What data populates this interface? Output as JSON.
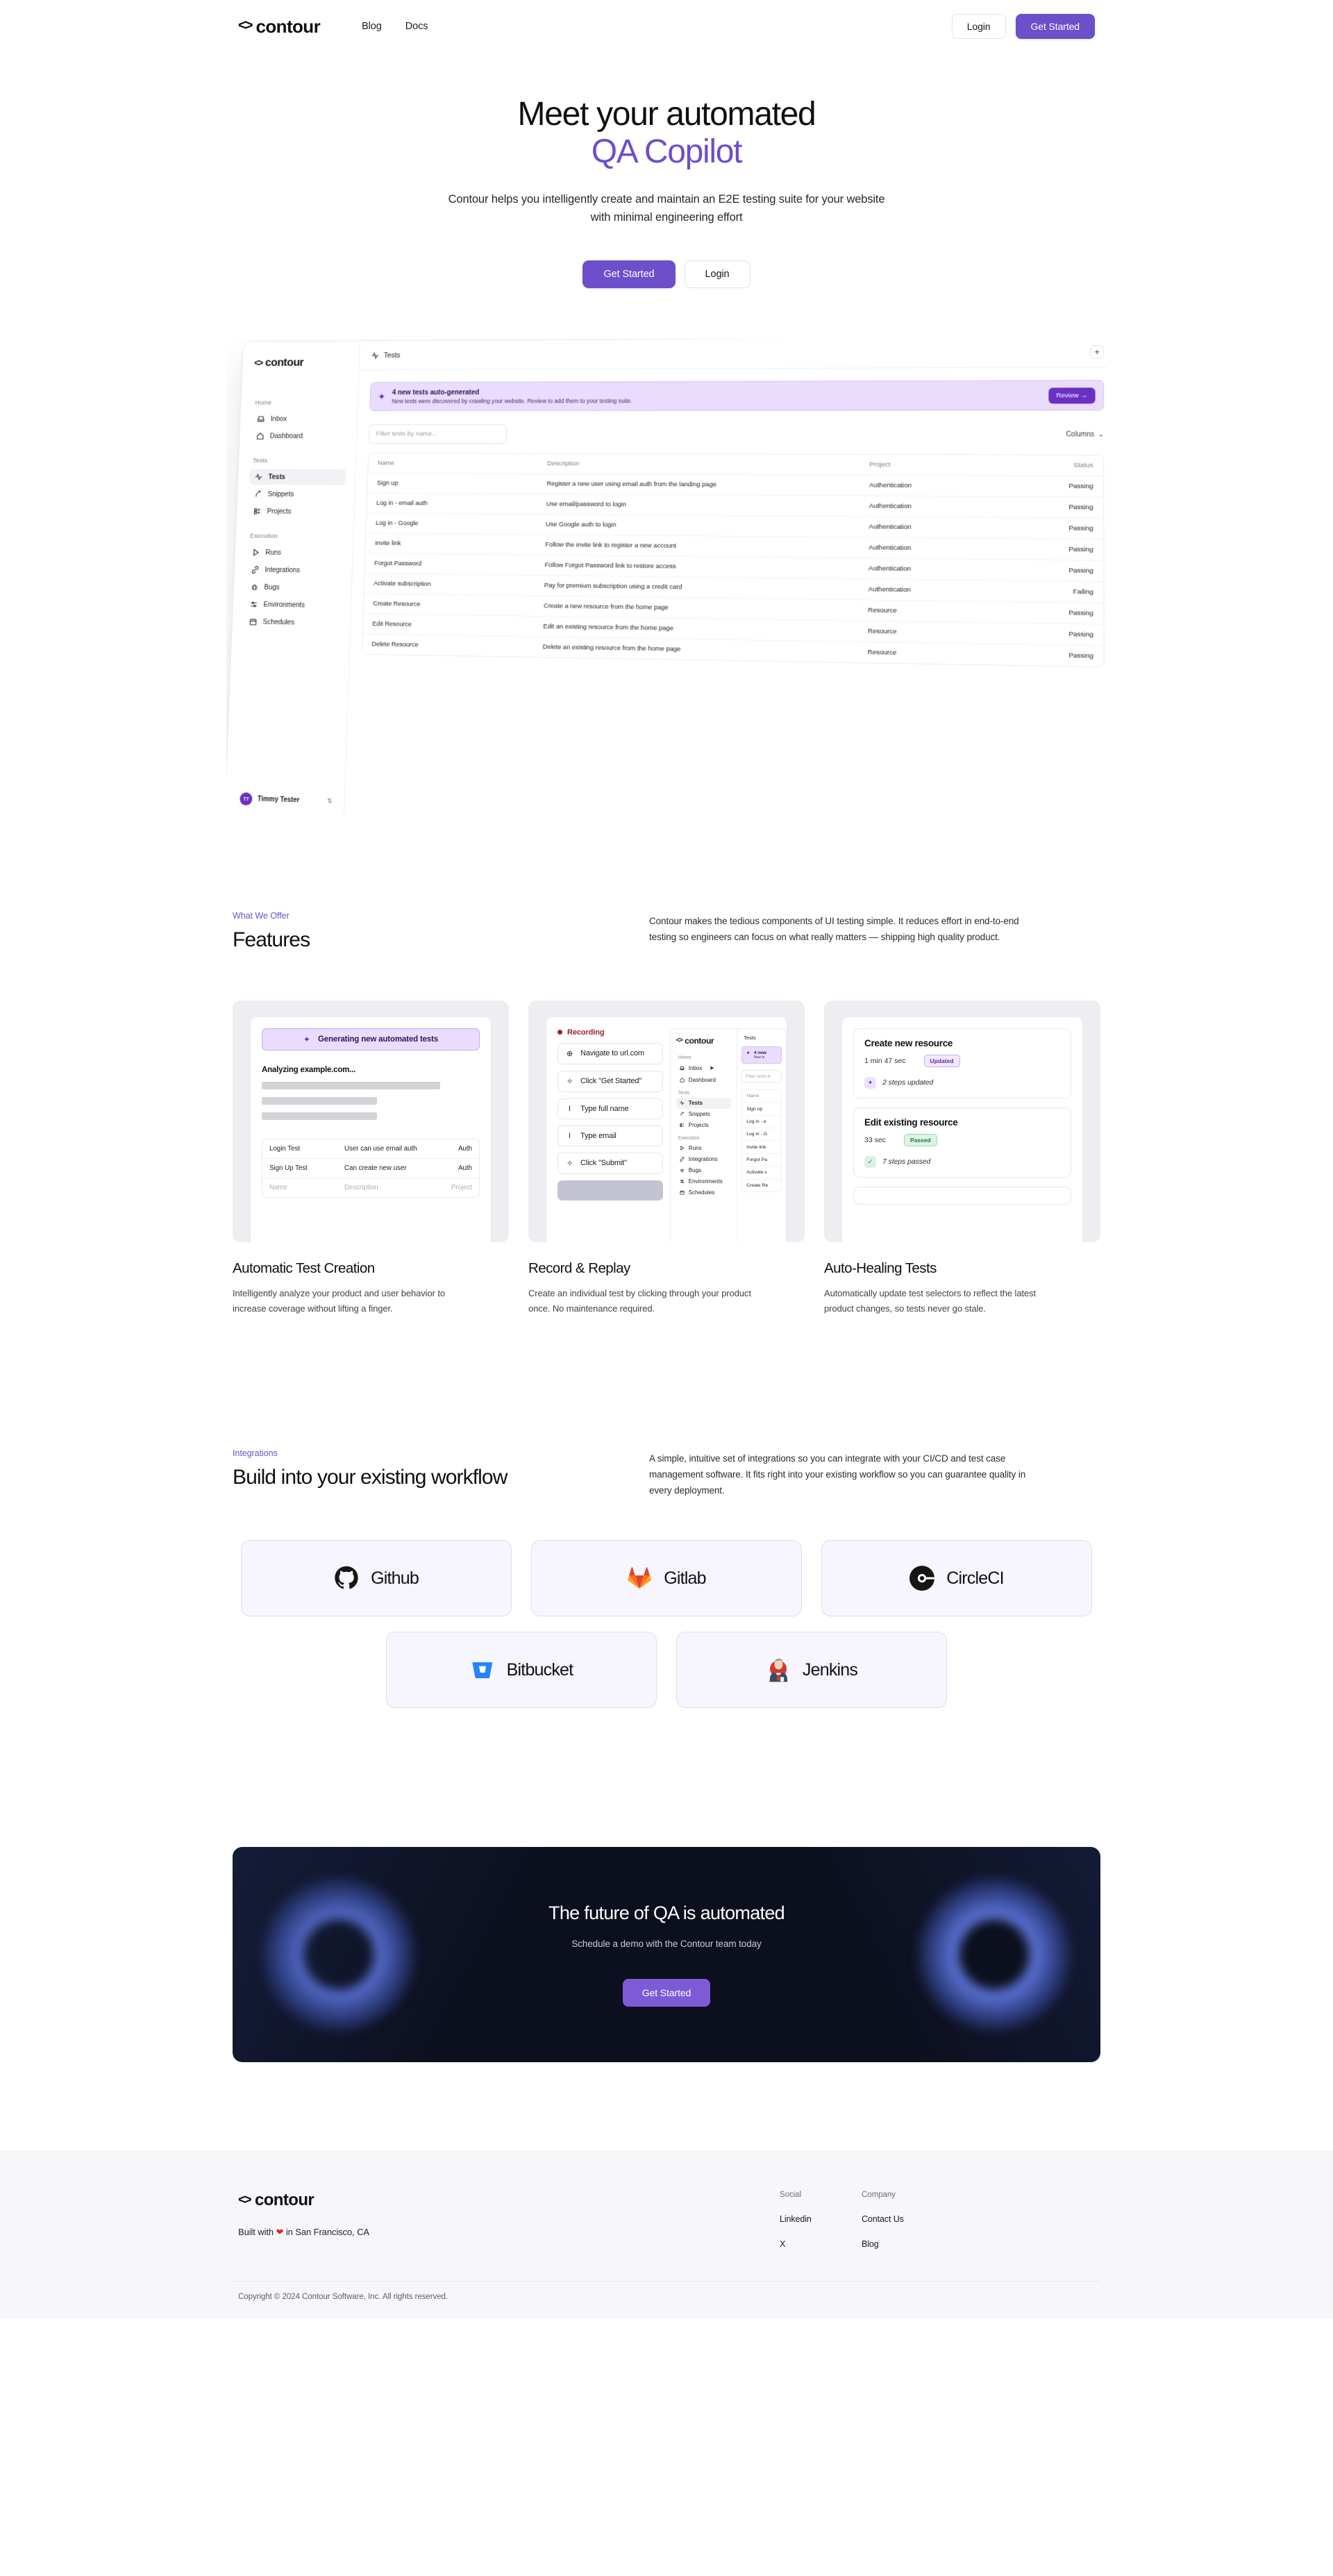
{
  "brand": {
    "name": "contour",
    "mark": "<>"
  },
  "nav": {
    "links": [
      {
        "label": "Blog"
      },
      {
        "label": "Docs"
      }
    ],
    "login_label": "Login",
    "get_started_label": "Get Started"
  },
  "hero": {
    "title_line1": "Meet your automated",
    "title_line2": "QA Copilot",
    "subtitle": "Contour helps you intelligently create and maintain an E2E testing suite for your website with minimal engineering effort",
    "primary_cta": "Get Started",
    "secondary_cta": "Login"
  },
  "app_mockup": {
    "logo": "contour",
    "sidebar": {
      "groups": [
        {
          "label": "Home",
          "items": [
            {
              "label": "Inbox",
              "icon": "inbox-icon",
              "active": false
            },
            {
              "label": "Dashboard",
              "icon": "home-icon",
              "active": false
            }
          ]
        },
        {
          "label": "Tests",
          "items": [
            {
              "label": "Tests",
              "icon": "pulse-icon",
              "active": true
            },
            {
              "label": "Snippets",
              "icon": "snippet-icon",
              "active": false
            },
            {
              "label": "Projects",
              "icon": "projects-icon",
              "active": false
            }
          ]
        },
        {
          "label": "Execution",
          "items": [
            {
              "label": "Runs",
              "icon": "play-icon",
              "active": false
            },
            {
              "label": "Integrations",
              "icon": "link-icon",
              "active": false
            },
            {
              "label": "Bugs",
              "icon": "bug-icon",
              "active": false
            },
            {
              "label": "Environments",
              "icon": "sliders-icon",
              "active": false
            },
            {
              "label": "Schedules",
              "icon": "calendar-icon",
              "active": false
            }
          ]
        }
      ],
      "user": {
        "initials": "TT",
        "name": "Timmy Tester"
      }
    },
    "topbar": {
      "title": "Tests",
      "add_label": "+"
    },
    "banner": {
      "title": "4 new tests auto-generated",
      "subtitle": "New tests were discovered by crawling your website. Review to add them to your testing suite.",
      "cta": "Review →"
    },
    "filter_placeholder": "Filter tests by name...",
    "columns_label": "Columns",
    "table": {
      "headers": [
        "Name",
        "Description",
        "Project",
        "Status"
      ],
      "rows": [
        {
          "name": "Sign up",
          "description": "Register a new user using email auth from the landing page",
          "project": "Authentication",
          "status": "Passing"
        },
        {
          "name": "Log in - email auth",
          "description": "Use email/password to login",
          "project": "Authentication",
          "status": "Passing"
        },
        {
          "name": "Log in - Google",
          "description": "Use Google auth to login",
          "project": "Authentication",
          "status": "Passing"
        },
        {
          "name": "Invite link",
          "description": "Follow the invite link to register a new account",
          "project": "Authentication",
          "status": "Passing"
        },
        {
          "name": "Forgot Password",
          "description": "Follow Forgot Password link to restore access",
          "project": "Authentication",
          "status": "Passing"
        },
        {
          "name": "Activate subscription",
          "description": "Pay for premium subscription using a credit card",
          "project": "Authentication",
          "status": "Failing"
        },
        {
          "name": "Create Resource",
          "description": "Create a new resource from the home page",
          "project": "Resource",
          "status": "Passing"
        },
        {
          "name": "Edit Resource",
          "description": "Edit an existing resource from the home page",
          "project": "Resource",
          "status": "Passing"
        },
        {
          "name": "Delete Resource",
          "description": "Delete an existing resource from the home page",
          "project": "Resource",
          "status": "Passing"
        }
      ]
    }
  },
  "features_section": {
    "eyebrow": "What We Offer",
    "title": "Features",
    "description": "Contour makes the tedious components of UI testing simple. It reduces effort in end-to-end testing so engineers can focus on what really matters — shipping high quality product.",
    "cards": [
      {
        "title": "Automatic Test Creation",
        "description": "Intelligently analyze your product and user behavior to increase coverage without lifting a finger.",
        "mock": {
          "pill": "Generating new automated tests",
          "analyzing": "Analyzing example.com...",
          "mini_rows": [
            {
              "c1": "Login Test",
              "c2": "User can use email auth",
              "c3": "Auth"
            },
            {
              "c1": "Sign Up Test",
              "c2": "Can create new user",
              "c3": "Auth"
            },
            {
              "c1": "Name",
              "c2": "Description",
              "c3": "Project"
            }
          ]
        }
      },
      {
        "title": "Record & Replay",
        "description": "Create an individual test by clicking through your product once. No maintenance required.",
        "mock": {
          "recording_label": "Recording",
          "steps": [
            {
              "icon": "globe-icon",
              "glyph": "⊕",
              "label": "Navigate to url.com"
            },
            {
              "icon": "click-icon",
              "glyph": "✧",
              "label": "Click \"Get Started\""
            },
            {
              "icon": "text-cursor-icon",
              "glyph": "I",
              "label": "Type full name"
            },
            {
              "icon": "text-cursor-icon",
              "glyph": "I",
              "label": "Type email"
            },
            {
              "icon": "click-icon",
              "glyph": "✧",
              "label": "Click \"Submit\""
            }
          ],
          "app_logo": "contour",
          "tab": "Tests",
          "banner_title": "4 new",
          "banner_sub": "New te",
          "filter_placeholder": "Filter tests b",
          "sidebar_groups": [
            {
              "label": "Home",
              "items": [
                "Inbox",
                "Dashboard"
              ]
            },
            {
              "label": "Tests",
              "items": [
                "Tests",
                "Snippets",
                "Projects"
              ]
            },
            {
              "label": "Execution",
              "items": [
                "Runs",
                "Integrations",
                "Bugs",
                "Environments",
                "Schedules"
              ]
            }
          ],
          "rows": [
            "Name",
            "Sign up",
            "Log in - e",
            "Log in - G",
            "Invite link",
            "Forgot Pa",
            "Activate s",
            "Create Re"
          ]
        }
      },
      {
        "title": "Auto-Healing Tests",
        "description": "Automatically update test selectors to reflect the latest product changes, so tests never go stale.",
        "mock": {
          "cards": [
            {
              "title": "Create new resource",
              "time": "1 min 47 sec",
              "tag": "Updated",
              "tag_kind": "updated",
              "foot": "2 steps updated",
              "foot_icon": "sparkle-icon"
            },
            {
              "title": "Edit existing resource",
              "time": "33 sec",
              "tag": "Passed",
              "tag_kind": "passed",
              "foot": "7 steps passed",
              "foot_icon": "check-icon"
            }
          ]
        }
      }
    ]
  },
  "integrations_section": {
    "eyebrow": "Integrations",
    "title": "Build into your existing workflow",
    "description": "A simple, intuitive set of integrations so you can integrate with your CI/CD and test case management software. It fits right into your existing workflow so you can guarantee quality in every deployment.",
    "row1": [
      {
        "label": "Github",
        "icon": "github-icon"
      },
      {
        "label": "Gitlab",
        "icon": "gitlab-icon"
      },
      {
        "label": "CircleCI",
        "icon": "circleci-icon"
      }
    ],
    "row2": [
      {
        "label": "Bitbucket",
        "icon": "bitbucket-icon"
      },
      {
        "label": "Jenkins",
        "icon": "jenkins-icon"
      }
    ]
  },
  "cta": {
    "title": "The future of QA is automated",
    "subtitle": "Schedule a demo with the Contour team today",
    "button": "Get Started"
  },
  "footer": {
    "logo": "contour",
    "tagline_before": "Built with ",
    "tagline_heart": "❤",
    "tagline_after": " in San Francisco, CA",
    "columns": [
      {
        "title": "Social",
        "links": [
          "Linkedin",
          "X"
        ]
      },
      {
        "title": "Company",
        "links": [
          "Contact Us",
          "Blog"
        ]
      }
    ],
    "copyright": "Copyright © 2024 Contour Software, Inc. All rights reserved."
  },
  "colors": {
    "accent": "#6d4ecb",
    "accent_deep": "#6930c3",
    "banner_bg": "#eadcfc",
    "pass": "#1c8a4e",
    "fail": "#e0573d",
    "cta_bg": "#0c0f1d"
  }
}
